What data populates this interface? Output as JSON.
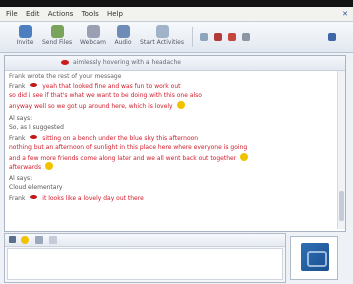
{
  "menu": {
    "items": [
      "File",
      "Edit",
      "Actions",
      "Tools",
      "Help"
    ]
  },
  "toolbar": {
    "buttons": [
      {
        "label": "Invite",
        "icon": "invite-user-icon"
      },
      {
        "label": "Send Files",
        "icon": "send-files-icon"
      },
      {
        "label": "Webcam",
        "icon": "webcam-icon"
      },
      {
        "label": "Audio",
        "icon": "audio-icon"
      },
      {
        "label": "Start Activities",
        "icon": "activities-icon"
      }
    ]
  },
  "chat": {
    "header_text": "aimlessly hovering with a headache",
    "messages": [
      {
        "sender": "",
        "text": "Frank wrote the rest of your message"
      },
      {
        "sender": "Frank",
        "text": "yeah that looked fine and was fun to work out",
        "color": "#d11b2a"
      },
      {
        "sender": "",
        "text": "so did i see if that's what we want to be doing with this one also",
        "color": "#d11b2a"
      },
      {
        "sender": "",
        "text": "anyway well so we got up around here, which is lovely",
        "color": "#d11b2a"
      },
      {
        "sender": "Al says:",
        "text": ""
      },
      {
        "sender": "",
        "text": "So, as I suggested"
      },
      {
        "sender": "Frank",
        "text": "sitting on a bench under the blue sky this afternoon",
        "color": "#d11b2a"
      },
      {
        "sender": "",
        "text": "nothing but an afternoon of sunlight in this place here where everyone is going",
        "color": "#d11b2a"
      },
      {
        "sender": "",
        "text": "and a few more friends come along later and we all went back out together",
        "color": "#d11b2a"
      },
      {
        "sender": "",
        "text": "afterwards",
        "color": "#d11b2a"
      },
      {
        "sender": "Al says:",
        "text": ""
      },
      {
        "sender": "",
        "text": "Cloud elementary"
      },
      {
        "sender": "Frank",
        "text": "it looks like a lovely day out there",
        "color": "#d11b2a"
      }
    ]
  },
  "input": {
    "placeholder": ""
  },
  "colors": {
    "accent": "#2f6fb5",
    "message_red": "#d11b2a",
    "emoticon_yellow": "#f2c200"
  }
}
